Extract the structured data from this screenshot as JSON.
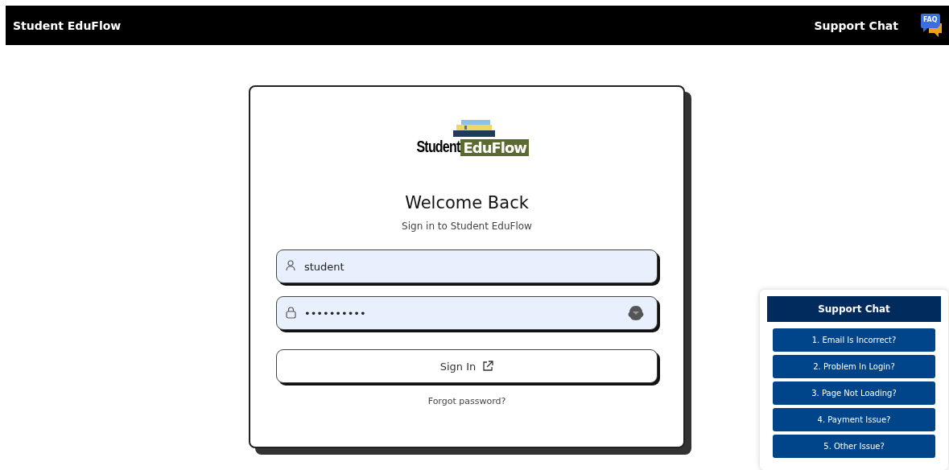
{
  "top_bar": {
    "brand": "Student EduFlow",
    "support_link": "Support Chat",
    "faq_badge": "FAQ"
  },
  "login": {
    "logo": {
      "word_1": "Student",
      "word_2": "EduFlow"
    },
    "title": "Welcome Back",
    "subtitle": "Sign in to Student EduFlow",
    "fields": [
      {
        "kind": "username",
        "value": "student"
      },
      {
        "kind": "password",
        "value": "••••••••••"
      }
    ],
    "submit": "Sign In",
    "forgot": "Forgot password?"
  },
  "support_chat": {
    "title": "Support Chat",
    "options": [
      "1. Email Is Incorrect?",
      "2. Problem In Login?",
      "3. Page Not Loading?",
      "4. Payment Issue?",
      "5. Other Issue?"
    ]
  }
}
